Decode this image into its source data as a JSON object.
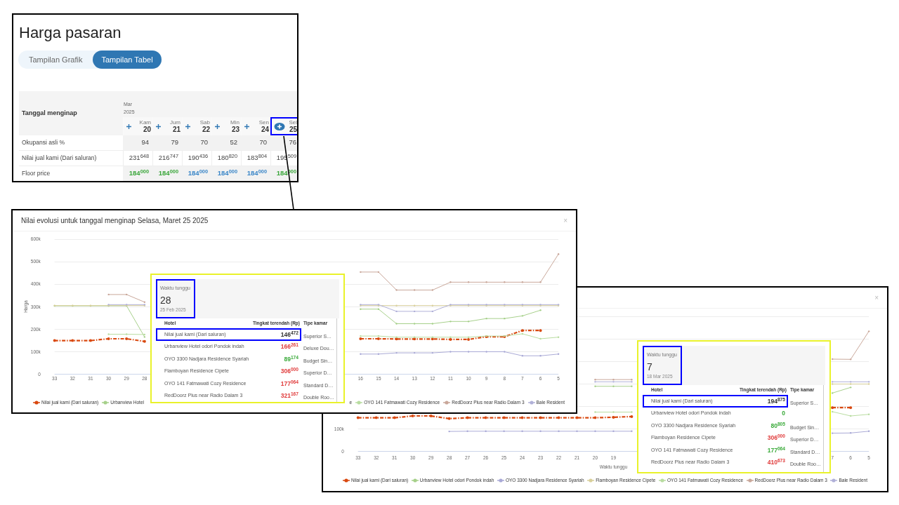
{
  "market_panel": {
    "title": "Harga pasaran",
    "view_toggle": [
      {
        "label": "Tampilan Grafik",
        "selected": false
      },
      {
        "label": "Tampilan Tabel",
        "selected": true
      }
    ],
    "table": {
      "header_label": "Tanggal menginap",
      "month": "Mar",
      "year": "2025",
      "columns": [
        {
          "day": "Kam",
          "date": "20",
          "selected": false,
          "highlighted": false
        },
        {
          "day": "Jum",
          "date": "21",
          "selected": false,
          "highlighted": false
        },
        {
          "day": "Sab",
          "date": "22",
          "selected": false,
          "highlighted": false
        },
        {
          "day": "Min",
          "date": "23",
          "selected": false,
          "highlighted": false
        },
        {
          "day": "Sen",
          "date": "24",
          "selected": false,
          "highlighted": false
        },
        {
          "day": "Sel",
          "date": "25",
          "selected": true,
          "highlighted": true
        }
      ],
      "rows": [
        {
          "label": "Okupansi asli %",
          "kind": "shaded",
          "cells": [
            {
              "value": "94"
            },
            {
              "value": "79"
            },
            {
              "value": "70"
            },
            {
              "value": "52"
            },
            {
              "value": "70"
            },
            {
              "value": "76"
            }
          ]
        },
        {
          "label": "Nilai jual kami (Dari saluran)",
          "kind": "plain",
          "cells": [
            {
              "value": "231$^{648}$"
            },
            {
              "value": "216$^{747}$"
            },
            {
              "value": "190$^{436}$"
            },
            {
              "value": "180$^{820}$"
            },
            {
              "value": "183$^{804}$"
            },
            {
              "value": "195$^{509}$"
            }
          ]
        },
        {
          "label": "Floor price",
          "kind": "shaded",
          "cells": [
            {
              "value": "184$^{000}$",
              "color": "#3aa63a"
            },
            {
              "value": "184$^{000}$",
              "color": "#3aa63a"
            },
            {
              "value": "184$^{000}$",
              "color": "#3a86c8"
            },
            {
              "value": "184$^{000}$",
              "color": "#3a86c8"
            },
            {
              "value": "184$^{000}$",
              "color": "#3a86c8"
            },
            {
              "value": "184$^{000}$",
              "color": "#3aa63a"
            }
          ]
        }
      ]
    }
  },
  "evolution_panels": [
    {
      "title": "Nilai evolusi untuk tanggal menginap Selasa, Maret 25 2025",
      "close": "×",
      "chart_data": {
        "type": "line",
        "ylabel": "Harga",
        "grid": true,
        "x": [
          33,
          32,
          31,
          30,
          29,
          28,
          16,
          15,
          14,
          13,
          12,
          11,
          10,
          9,
          8,
          7,
          6,
          5
        ],
        "xlim": [
          33,
          5
        ],
        "xticks": [
          33,
          32,
          31,
          30,
          29,
          28,
          16,
          15,
          14,
          13,
          12,
          11,
          10,
          9,
          8,
          7,
          6,
          5
        ],
        "ylim": [
          0,
          600000
        ],
        "yticks": [
          {
            "value": 0,
            "label": "0"
          },
          {
            "value": 100000,
            "label": "100k"
          },
          {
            "value": 200000,
            "label": "200k"
          },
          {
            "value": 300000,
            "label": "300k"
          },
          {
            "value": 400000,
            "label": "400k"
          },
          {
            "value": 500000,
            "label": "500k"
          },
          {
            "value": 600000,
            "label": "600k"
          }
        ],
        "series": [
          {
            "color": "#d9480f",
            "line_style": "dashed",
            "values": [
              150000,
              150000,
              150000,
              158000,
              158000,
              146000,
              158000,
              158000,
              157000,
              157000,
              157000,
              155000,
              155000,
              167000,
              167000,
              195000,
              195000,
              null
            ]
          },
          {
            "color": "#a6d08a",
            "line_style": "solid",
            "values": [
              305000,
              305000,
              305000,
              305000,
              305000,
              166000,
              290000,
              290000,
              225000,
              225000,
              225000,
              235000,
              235000,
              248000,
              248000,
              260000,
              285000,
              null
            ]
          },
          {
            "color": "#a9a9d6",
            "line_style": "solid",
            "values": [
              null,
              null,
              null,
              null,
              null,
              null,
              90000,
              90000,
              95000,
              95000,
              95000,
              100000,
              100000,
              100000,
              100000,
              82000,
              82000,
              90000
            ]
          },
          {
            "color": "#d8cf9a",
            "line_style": "solid",
            "values": [
              306000,
              306000,
              306000,
              306000,
              306000,
              306000,
              306000,
              306000,
              306000,
              306000,
              306000,
              306000,
              306000,
              306000,
              306000,
              306000,
              306000,
              306000
            ]
          },
          {
            "color": "#b8dca0",
            "line_style": "solid",
            "values": [
              null,
              null,
              null,
              178000,
              178000,
              177000,
              170000,
              170000,
              165000,
              165000,
              165000,
              165000,
              165000,
              170000,
              170000,
              180000,
              158000,
              165000
            ]
          },
          {
            "color": "#c9a79a",
            "line_style": "solid",
            "values": [
              null,
              null,
              null,
              355000,
              355000,
              321000,
              455000,
              455000,
              375000,
              375000,
              375000,
              410000,
              410000,
              410000,
              410000,
              410000,
              410000,
              535000
            ]
          },
          {
            "color": "#b0b0d8",
            "line_style": "solid",
            "values": [
              null,
              null,
              null,
              310000,
              310000,
              310000,
              310000,
              310000,
              280000,
              280000,
              280000,
              310000,
              310000,
              310000,
              310000,
              310000,
              310000,
              310000
            ]
          }
        ]
      },
      "legend": [
        {
          "label": "Nilai jual kami (Dari saluran)",
          "color": "#d9480f",
          "marker": true
        },
        {
          "label": "Urbanview Hotel",
          "color": "#a6d08a",
          "marker": true
        },
        {
          "label": "e",
          "marker": false
        },
        {
          "label": "OYO 141 Fatmawati Cozy Residence",
          "color": "#b8dca0",
          "marker": true
        },
        {
          "label": "RedDoorz Plus near Radio Dalam 3",
          "color": "#c9a79a",
          "marker": true
        },
        {
          "label": "Bale Resident",
          "color": "#b0b0d8",
          "marker": true
        }
      ],
      "tooltip": {
        "label": "Waktu tunggu",
        "value": "28",
        "date": "25 Feb 2025",
        "highlighted": true,
        "columns": [
          "Hotel",
          "Tingkat terendah (Rp)",
          "Tipe kamar"
        ],
        "rows": [
          {
            "hotel": "Nilai jual kami (Dari saluran)",
            "price": "146$^{472}$",
            "color": "#333333",
            "type": "Superior S…",
            "highlighted": true
          },
          {
            "hotel": "Urbanview Hotel odori Pondok indah",
            "price": "166$^{261}$",
            "color": "#e03a3a",
            "type": "Deluxe Dou…",
            "highlighted": false
          },
          {
            "hotel": "OYO 3300 Nadjara Residence Syariah",
            "price": "89$^{174}$",
            "color": "#3aaa3a",
            "type": "Budget Sin…",
            "highlighted": false
          },
          {
            "hotel": "Flamboyan Residence Cipete",
            "price": "306$^{000}$",
            "color": "#e03a3a",
            "type": "Superior D…",
            "highlighted": false
          },
          {
            "hotel": "OYO 141 Fatmawati Cozy Residence",
            "price": "177$^{064}$",
            "color": "#e03a3a",
            "type": "Standard D…",
            "highlighted": false
          },
          {
            "hotel": "RedDoorz Plus near Radio Dalam 3",
            "price": "321$^{167}$",
            "color": "#e03a3a",
            "type": "Double Roo…",
            "highlighted": false
          }
        ]
      }
    },
    {
      "close": "×",
      "chart_data": {
        "type": "line",
        "xlabel": "Waktu tunggu",
        "grid": true,
        "x": [
          33,
          32,
          31,
          30,
          29,
          28,
          27,
          26,
          25,
          24,
          23,
          22,
          21,
          20,
          19,
          18,
          7,
          6,
          5
        ],
        "xlim": [
          33,
          5
        ],
        "xticks": [
          33,
          32,
          31,
          30,
          29,
          28,
          27,
          26,
          25,
          24,
          23,
          22,
          21,
          20,
          19,
          7,
          6,
          5
        ],
        "ylim": [
          0,
          600000
        ],
        "yticks": [
          {
            "value": 0,
            "label": "0"
          },
          {
            "value": 100000,
            "label": "100k"
          }
        ],
        "series": [
          {
            "name": "Nilai jual kami (Dari saluran)",
            "color": "#d9480f",
            "line_style": "dashed",
            "values": [
              150000,
              150000,
              150000,
              158000,
              158000,
              146000,
              150000,
              150000,
              150000,
              150000,
              150000,
              150000,
              150000,
              150000,
              152000,
              155000,
              195000,
              195000,
              null
            ]
          },
          {
            "name": "Urbanview Hotel odori Pondok indah",
            "color": "#a6d08a",
            "line_style": "solid",
            "values": [
              null,
              null,
              null,
              null,
              null,
              null,
              null,
              null,
              null,
              null,
              null,
              null,
              null,
              290000,
              290000,
              290000,
              260000,
              285000,
              null
            ]
          },
          {
            "name": "OYO 3300 Nadjara Residence Syariah",
            "color": "#a9a9d6",
            "line_style": "solid",
            "values": [
              null,
              null,
              null,
              null,
              null,
              89000,
              90000,
              90000,
              90000,
              90000,
              90000,
              90000,
              90000,
              90000,
              90000,
              90000,
              81000,
              82000,
              90000
            ]
          },
          {
            "name": "Flamboyan Residence Cipete",
            "color": "#d8cf9a",
            "line_style": "solid",
            "values": [
              null,
              null,
              null,
              null,
              null,
              null,
              null,
              null,
              null,
              null,
              null,
              null,
              null,
              null,
              null,
              null,
              300000,
              300000,
              300000
            ]
          },
          {
            "name": "OYO 141 Fatmawati Cozy Residence",
            "color": "#b8dca0",
            "line_style": "solid",
            "values": [
              null,
              null,
              null,
              null,
              null,
              null,
              null,
              null,
              null,
              null,
              null,
              null,
              null,
              175000,
              175000,
              175000,
              177000,
              158000,
              165000
            ]
          },
          {
            "name": "RedDoorz Plus near Radio Dalam 3",
            "color": "#c9a79a",
            "line_style": "solid",
            "values": [
              null,
              null,
              null,
              null,
              null,
              null,
              null,
              null,
              null,
              null,
              null,
              null,
              null,
              320000,
              320000,
              320000,
              411000,
              410000,
              535000
            ]
          },
          {
            "name": "Bale Resident",
            "color": "#b0b0d8",
            "line_style": "solid",
            "values": [
              null,
              null,
              null,
              null,
              null,
              null,
              null,
              null,
              null,
              null,
              null,
              null,
              null,
              310000,
              310000,
              310000,
              310000,
              310000,
              310000
            ]
          }
        ]
      },
      "tooltip": {
        "label": "Waktu tunggu",
        "value": "7",
        "date": "18 Mar 2025",
        "highlighted": true,
        "columns": [
          "Hotel",
          "Tingkat terendah (Rp)",
          "Tipe kamar"
        ],
        "rows": [
          {
            "hotel": "Nilai jual kami (Dari saluran)",
            "price": "194$^{875}$",
            "color": "#333333",
            "type": "Superior S…",
            "highlighted": true
          },
          {
            "hotel": "Urbanview Hotel odori Pondok indah",
            "price": "0",
            "color": "#3aaa3a",
            "highlighted": false
          },
          {
            "hotel": "OYO 3300 Nadjara Residence Syariah",
            "price": "80$^{805}$",
            "color": "#3aaa3a",
            "type": "Budget Sin…",
            "highlighted": false
          },
          {
            "hotel": "Flamboyan Residence Cipete",
            "price": "306$^{000}$",
            "color": "#e03a3a",
            "type": "Superior D…",
            "highlighted": false
          },
          {
            "hotel": "OYO 141 Fatmawati Cozy Residence",
            "price": "177$^{064}$",
            "color": "#3aaa3a",
            "type": "Standard D…",
            "highlighted": false
          },
          {
            "hotel": "RedDoorz Plus near Radio Dalam 3",
            "price": "410$^{673}$",
            "color": "#e03a3a",
            "type": "Double Roo…",
            "highlighted": false
          }
        ]
      }
    }
  ]
}
